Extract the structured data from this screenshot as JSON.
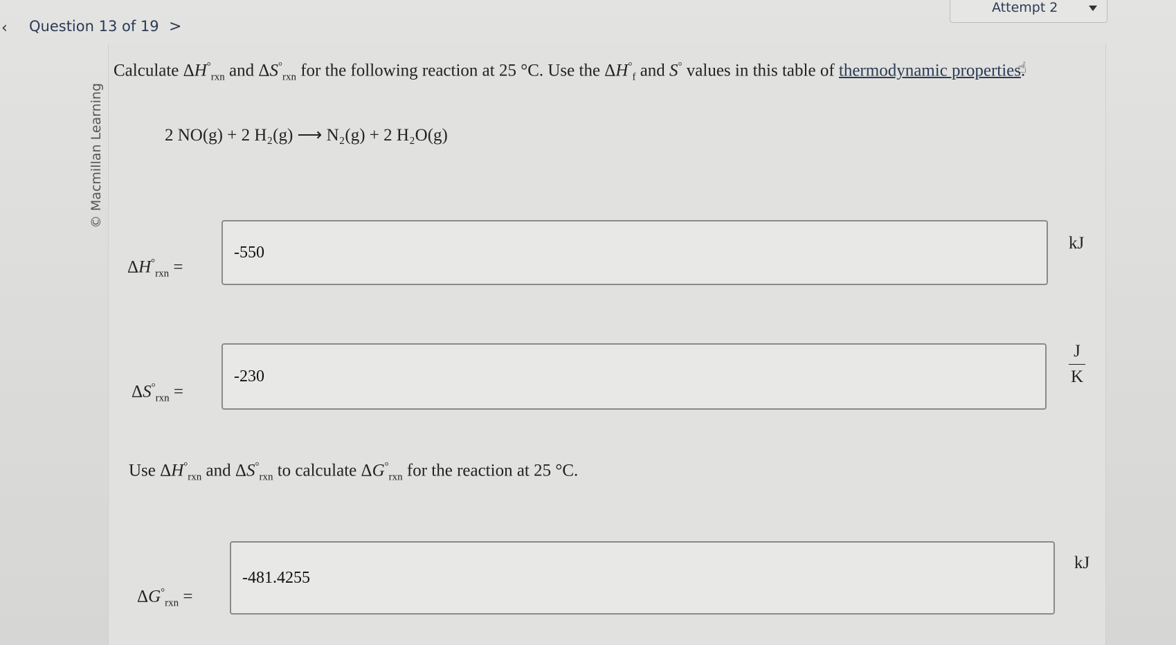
{
  "header": {
    "question_label": "Question 13 of 19",
    "attempt_label": "Attempt 2"
  },
  "watermark": "© Macmillan Learning",
  "prompt": {
    "calculate": "Calculate",
    "and": "and",
    "for_following": "for the following reaction at 25 °C. Use the",
    "and2": "and",
    "values_in_table": "values in this table of",
    "link_text": "thermodynamic properties",
    "period": "."
  },
  "equation": "2 NO(g) + 2 H₂(g) ⟶ N₂(g) + 2 H₂O(g)",
  "fields": {
    "dh": {
      "label": "ΔH°rxn =",
      "value": "-550",
      "unit": "kJ"
    },
    "ds": {
      "label": "ΔS°rxn =",
      "value": "-230",
      "unit_num": "J",
      "unit_den": "K"
    },
    "dg": {
      "label": "ΔG°rxn =",
      "value": "-481.4255",
      "unit": "kJ"
    }
  },
  "instruction": {
    "use": "Use",
    "and": "and",
    "to_calculate": "to calculate",
    "for_reaction": "for the reaction at 25 °C."
  }
}
